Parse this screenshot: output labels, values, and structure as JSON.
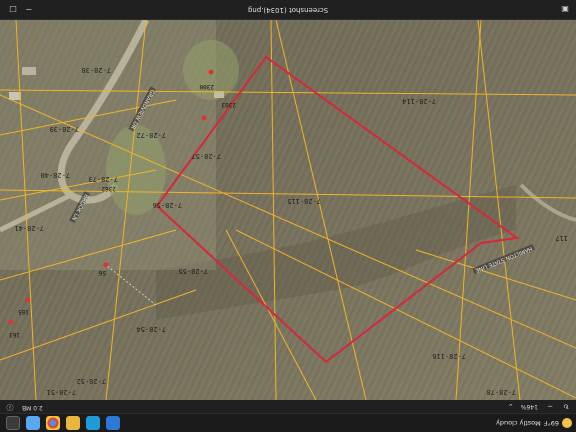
{
  "taskbar": {
    "weather_temp": "69°F",
    "weather_desc": "Mostly cloudy",
    "pinned_icons": [
      "start-icon",
      "edge-icon",
      "file-explorer-icon",
      "chrome-icon",
      "photos-icon",
      "store-icon"
    ]
  },
  "viewer_toolbar": {
    "zoom_label": "146%",
    "file_info": "2.0 MB"
  },
  "status_bar": {
    "filename": "Screenshot (1034).png"
  },
  "map": {
    "parcels": [
      {
        "id": "p1",
        "label": "7-28-115"
      },
      {
        "id": "p2",
        "label": "7-28-114"
      },
      {
        "id": "p3",
        "label": "7-28-116"
      },
      {
        "id": "p4",
        "label": "7-28-55"
      },
      {
        "id": "p5",
        "label": "7-28-56"
      },
      {
        "id": "p6",
        "label": "7-28-57"
      },
      {
        "id": "p7",
        "label": "7-28-54"
      },
      {
        "id": "p8",
        "label": "7-28-73"
      },
      {
        "id": "p9",
        "label": "7-28-72"
      },
      {
        "id": "p10",
        "label": "7-28-40"
      },
      {
        "id": "p11",
        "label": "7-28-41"
      },
      {
        "id": "p12",
        "label": "7-28-39"
      },
      {
        "id": "p13",
        "label": "7-28-38"
      },
      {
        "id": "p14",
        "label": "7-28-52"
      },
      {
        "id": "p15",
        "label": "7-28-51"
      },
      {
        "id": "p16",
        "label": "7-28-78"
      },
      {
        "id": "p17",
        "label": "117"
      }
    ],
    "roads": [
      {
        "id": "r1",
        "label": "GRANDVIEW DR"
      },
      {
        "id": "r2",
        "label": "HAMILTON STATE LINE"
      },
      {
        "id": "r3",
        "label": "BROOK LN"
      }
    ],
    "addresses": [
      {
        "id": "a1",
        "label": "2303"
      },
      {
        "id": "a2",
        "label": "2300"
      },
      {
        "id": "a3",
        "label": "2362"
      },
      {
        "id": "a4",
        "label": "56"
      },
      {
        "id": "a5",
        "label": "105"
      },
      {
        "id": "a6",
        "label": "163"
      }
    ],
    "highlight_color": "#d6283a",
    "parcel_line_color": "#f0b42a"
  }
}
